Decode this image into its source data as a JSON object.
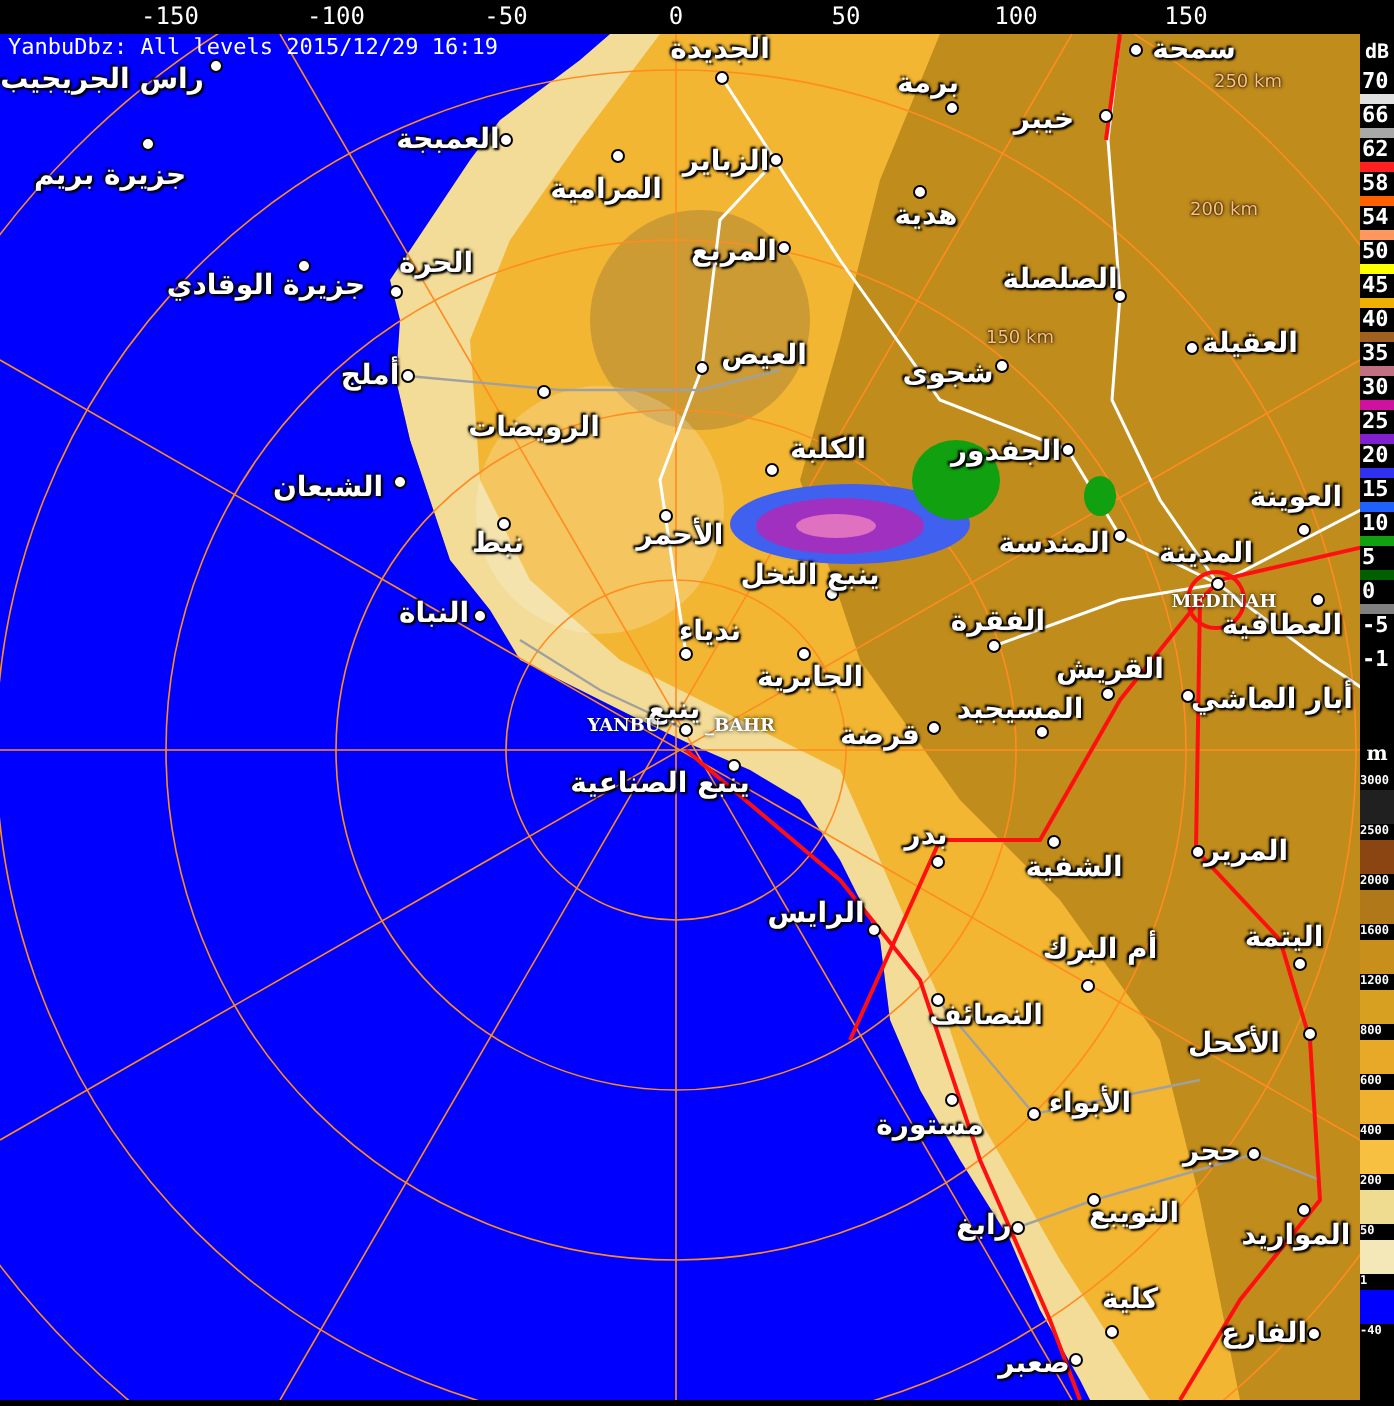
{
  "x_axis": {
    "ticks": [
      "150",
      "100",
      "50",
      "0",
      "-50",
      "-100",
      "-150"
    ]
  },
  "header": "YanbuDbz: All levels 2015/12/29 16:19",
  "labels": [
    {
      "name": "سمحة",
      "kind": "town"
    },
    {
      "name": "الجديدة",
      "kind": "town"
    },
    {
      "name": "برمة",
      "kind": "town"
    },
    {
      "name": "راس الجريجيب",
      "kind": "town"
    },
    {
      "name": "خيبر",
      "kind": "town"
    },
    {
      "name": "الزباير",
      "kind": "town"
    },
    {
      "name": "العمبجة",
      "kind": "town"
    },
    {
      "name": "جزيرة بريم",
      "kind": "town"
    },
    {
      "name": "هدية",
      "kind": "town"
    },
    {
      "name": "المرامية",
      "kind": "town"
    },
    {
      "name": "المربع",
      "kind": "town"
    },
    {
      "name": "الصلصلة",
      "kind": "town"
    },
    {
      "name": "الحرة",
      "kind": "town"
    },
    {
      "name": "جزيرة الوقادي",
      "kind": "town"
    },
    {
      "name": "العقيلة",
      "kind": "town"
    },
    {
      "name": "شجوى",
      "kind": "town"
    },
    {
      "name": "العيص",
      "kind": "town"
    },
    {
      "name": "أملج",
      "kind": "town"
    },
    {
      "name": "الجفدور",
      "kind": "town"
    },
    {
      "name": "الكلبة",
      "kind": "town"
    },
    {
      "name": "الرويضات",
      "kind": "town"
    },
    {
      "name": "الشبعان",
      "kind": "town"
    },
    {
      "name": "العوينة",
      "kind": "town"
    },
    {
      "name": "المدينة",
      "kind": "town"
    },
    {
      "name": "المندسة",
      "kind": "town"
    },
    {
      "name": "الأحمر",
      "kind": "town"
    },
    {
      "name": "نبط",
      "kind": "town"
    },
    {
      "name": "ينبع النخل",
      "kind": "town"
    },
    {
      "name": "MEDINAH",
      "kind": "code"
    },
    {
      "name": "العطافية",
      "kind": "town"
    },
    {
      "name": "الفقرة",
      "kind": "town"
    },
    {
      "name": "ندياء",
      "kind": "town"
    },
    {
      "name": "النباة",
      "kind": "town"
    },
    {
      "name": "أبار الماشي",
      "kind": "town"
    },
    {
      "name": "القريش",
      "kind": "town"
    },
    {
      "name": "الجابرية",
      "kind": "town"
    },
    {
      "name": "المسيجيد",
      "kind": "town"
    },
    {
      "name": "قرضة",
      "kind": "town"
    },
    {
      "name": "_BAHR",
      "kind": "code"
    },
    {
      "name": "ينبع",
      "kind": "town"
    },
    {
      "name": "YANBU",
      "kind": "code"
    },
    {
      "name": "ينبع الصناعية",
      "kind": "town"
    },
    {
      "name": "المرير",
      "kind": "town"
    },
    {
      "name": "الشفية",
      "kind": "town"
    },
    {
      "name": "بدر",
      "kind": "town"
    },
    {
      "name": "اليتمة",
      "kind": "town"
    },
    {
      "name": "أم البرك",
      "kind": "town"
    },
    {
      "name": "الرايس",
      "kind": "town"
    },
    {
      "name": "الأكحل",
      "kind": "town"
    },
    {
      "name": "النصائف",
      "kind": "town"
    },
    {
      "name": "الأبواء",
      "kind": "town"
    },
    {
      "name": "مستورة",
      "kind": "town"
    },
    {
      "name": "حجر",
      "kind": "town"
    },
    {
      "name": "المواريد",
      "kind": "town"
    },
    {
      "name": "النويبع",
      "kind": "town"
    },
    {
      "name": "رابغ",
      "kind": "town"
    },
    {
      "name": "الفارع",
      "kind": "town"
    },
    {
      "name": "كلية",
      "kind": "town"
    },
    {
      "name": "صعبر",
      "kind": "town"
    },
    {
      "name": "250 km",
      "kind": "range"
    },
    {
      "name": "200 km",
      "kind": "range"
    },
    {
      "name": "150 km",
      "kind": "range"
    }
  ],
  "dbz_legend": {
    "unit": "dB",
    "items": [
      {
        "label": "70",
        "color": "#e0e0e0"
      },
      {
        "label": "66",
        "color": "#a8a8a8"
      },
      {
        "label": "62",
        "color": "#ff2020"
      },
      {
        "label": "58",
        "color": "#ff6000"
      },
      {
        "label": "54",
        "color": "#ff9860"
      },
      {
        "label": "50",
        "color": "#ffff00"
      },
      {
        "label": "45",
        "color": "#f0b000"
      },
      {
        "label": "40",
        "color": "#a06020"
      },
      {
        "label": "35",
        "color": "#c07080"
      },
      {
        "label": "30",
        "color": "#d010a0"
      },
      {
        "label": "25",
        "color": "#8020d0"
      },
      {
        "label": "20",
        "color": "#3030f0"
      },
      {
        "label": "15",
        "color": "#2060ff"
      },
      {
        "label": "10",
        "color": "#10a010"
      },
      {
        "label": "5",
        "color": "#006000"
      },
      {
        "label": "0",
        "color": "#808080"
      },
      {
        "label": "-5"
      },
      {
        "label": "-1"
      }
    ]
  },
  "elevation_legend": {
    "unit": "m",
    "items": [
      {
        "label": "3000",
        "color": "#202020"
      },
      {
        "label": "2500",
        "color": "#8b4513"
      },
      {
        "label": "2000",
        "color": "#b07818"
      },
      {
        "label": "1600",
        "color": "#c8901a"
      },
      {
        "label": "1200",
        "color": "#d8a020"
      },
      {
        "label": "800",
        "color": "#e8a828"
      },
      {
        "label": "600",
        "color": "#f0b030"
      },
      {
        "label": "400",
        "color": "#f8c040"
      },
      {
        "label": "200",
        "color": "#f0dc90"
      },
      {
        "label": "50",
        "color": "#f4e8b8"
      },
      {
        "label": "1",
        "color": "#0000ff"
      },
      {
        "label": "-40"
      }
    ]
  }
}
